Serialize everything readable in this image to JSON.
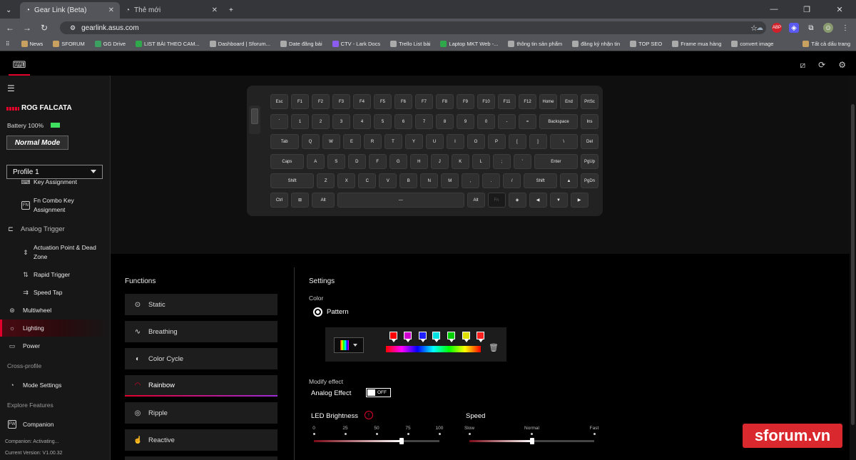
{
  "browser": {
    "tabs": [
      {
        "label": "Gear Link (Beta)"
      },
      {
        "label": "Thẻ mới"
      }
    ],
    "url": "gearlink.asus.com",
    "bookmarks": [
      {
        "label": "News",
        "color": "#c8a060"
      },
      {
        "label": "SFORUM",
        "color": "#c8a060"
      },
      {
        "label": "GG Drive",
        "color": "#3ca060"
      },
      {
        "label": "LIST BÀI THEO CAM...",
        "color": "#2ea84a"
      },
      {
        "label": "Dashboard | Sforum...",
        "color": "#aaaaaa"
      },
      {
        "label": "Date đăng bài",
        "color": "#aaaaaa"
      },
      {
        "label": "CTV - Lark Docs",
        "color": "#8a5cf0"
      },
      {
        "label": "Trello List bài",
        "color": "#aaaaaa"
      },
      {
        "label": "Laptop MKT Web -...",
        "color": "#2ea84a"
      },
      {
        "label": "thông tin sản phẩm",
        "color": "#aaaaaa"
      },
      {
        "label": "đăng ký nhận tin",
        "color": "#aaaaaa"
      },
      {
        "label": "TOP SEO",
        "color": "#aaaaaa"
      },
      {
        "label": "Frame mua hàng",
        "color": "#aaaaaa"
      },
      {
        "label": "convert image",
        "color": "#aaaaaa"
      },
      {
        "label": "Tất cả dấu trang",
        "color": "#c8a060"
      }
    ]
  },
  "sidebar": {
    "device_name": "ROG FALCATA",
    "battery": "Battery 100%",
    "mode": "Normal Mode",
    "profile": "Profile 1",
    "items": [
      {
        "label": "Key Assignment",
        "icon": "key-icon"
      },
      {
        "label": "Fn Combo Key Assignment",
        "icon": "fn-icon"
      },
      {
        "label": "Analog Trigger",
        "icon": "analog-icon"
      },
      {
        "label": "Actuation Point & Dead Zone",
        "icon": "actuation-icon"
      },
      {
        "label": "Rapid Trigger",
        "icon": "rapid-icon"
      },
      {
        "label": "Speed Tap",
        "icon": "speedtap-icon"
      },
      {
        "label": "Multiwheel",
        "icon": "wheel-icon"
      },
      {
        "label": "Lighting",
        "icon": "sun-icon"
      },
      {
        "label": "Power",
        "icon": "battery-icon"
      }
    ],
    "cross_profile": "Cross-profile",
    "mode_settings": "Mode Settings",
    "explore": "Explore Features",
    "companion": "Companion",
    "companion_status": "Companion: Activating...",
    "version": "Current Version: V1.00.32"
  },
  "keyboard": {
    "rows": [
      [
        "Esc",
        "F1",
        "F2",
        "F3",
        "F4",
        "F5",
        "F6",
        "F7",
        "F8",
        "F9",
        "F10",
        "F11",
        "F12",
        "Home",
        "End",
        "PrtSc"
      ],
      [
        "`",
        "1",
        "2",
        "3",
        "4",
        "5",
        "6",
        "7",
        "8",
        "9",
        "0",
        "-",
        "=",
        "Backspace",
        "Ins"
      ],
      [
        "Tab",
        "Q",
        "W",
        "E",
        "R",
        "T",
        "Y",
        "U",
        "I",
        "O",
        "P",
        "[",
        "]",
        "\\",
        "Del"
      ],
      [
        "Caps",
        "A",
        "S",
        "D",
        "F",
        "G",
        "H",
        "J",
        "K",
        "L",
        ";",
        "'",
        "Enter",
        "PgUp"
      ],
      [
        "Shift",
        "Z",
        "X",
        "C",
        "V",
        "B",
        "N",
        "M",
        ",",
        ".",
        "/",
        "Shift",
        "▲",
        "PgDn"
      ],
      [
        "Ctrl",
        "⊞",
        "Alt",
        "—",
        "Alt",
        "Fn",
        "◈",
        "◀",
        "▼",
        "▶"
      ]
    ]
  },
  "functions": {
    "title": "Functions",
    "items": [
      {
        "label": "Static",
        "icon": "static-icon",
        "glyph": "⊙"
      },
      {
        "label": "Breathing",
        "icon": "breathing-icon",
        "glyph": "∿"
      },
      {
        "label": "Color Cycle",
        "icon": "color-cycle-icon",
        "glyph": "◐"
      },
      {
        "label": "Rainbow",
        "icon": "rainbow-icon",
        "glyph": "◠"
      },
      {
        "label": "Ripple",
        "icon": "ripple-icon",
        "glyph": "◎"
      },
      {
        "label": "Reactive",
        "icon": "reactive-icon",
        "glyph": "☝"
      }
    ],
    "active": "Rainbow"
  },
  "settings": {
    "title": "Settings",
    "color_label": "Color",
    "pattern_label": "Pattern",
    "swatches": [
      "#ff0000",
      "#d000d0",
      "#2020ff",
      "#00e0e0",
      "#00d000",
      "#e0e000",
      "#ff2020"
    ],
    "modify_effect": "Modify effect",
    "analog_effect": "Analog Effect",
    "analog_state": "OFF",
    "led_brightness": {
      "label": "LED Brightness",
      "ticks": [
        "0",
        "25",
        "50",
        "75",
        "100"
      ],
      "value_fraction": 0.7
    },
    "speed": {
      "label": "Speed",
      "ticks": [
        "Slow",
        "Normal",
        "Fast"
      ],
      "value_fraction": 0.5
    }
  },
  "watermark": "sforum.vn",
  "colors": {
    "accent": "#e0002a"
  }
}
